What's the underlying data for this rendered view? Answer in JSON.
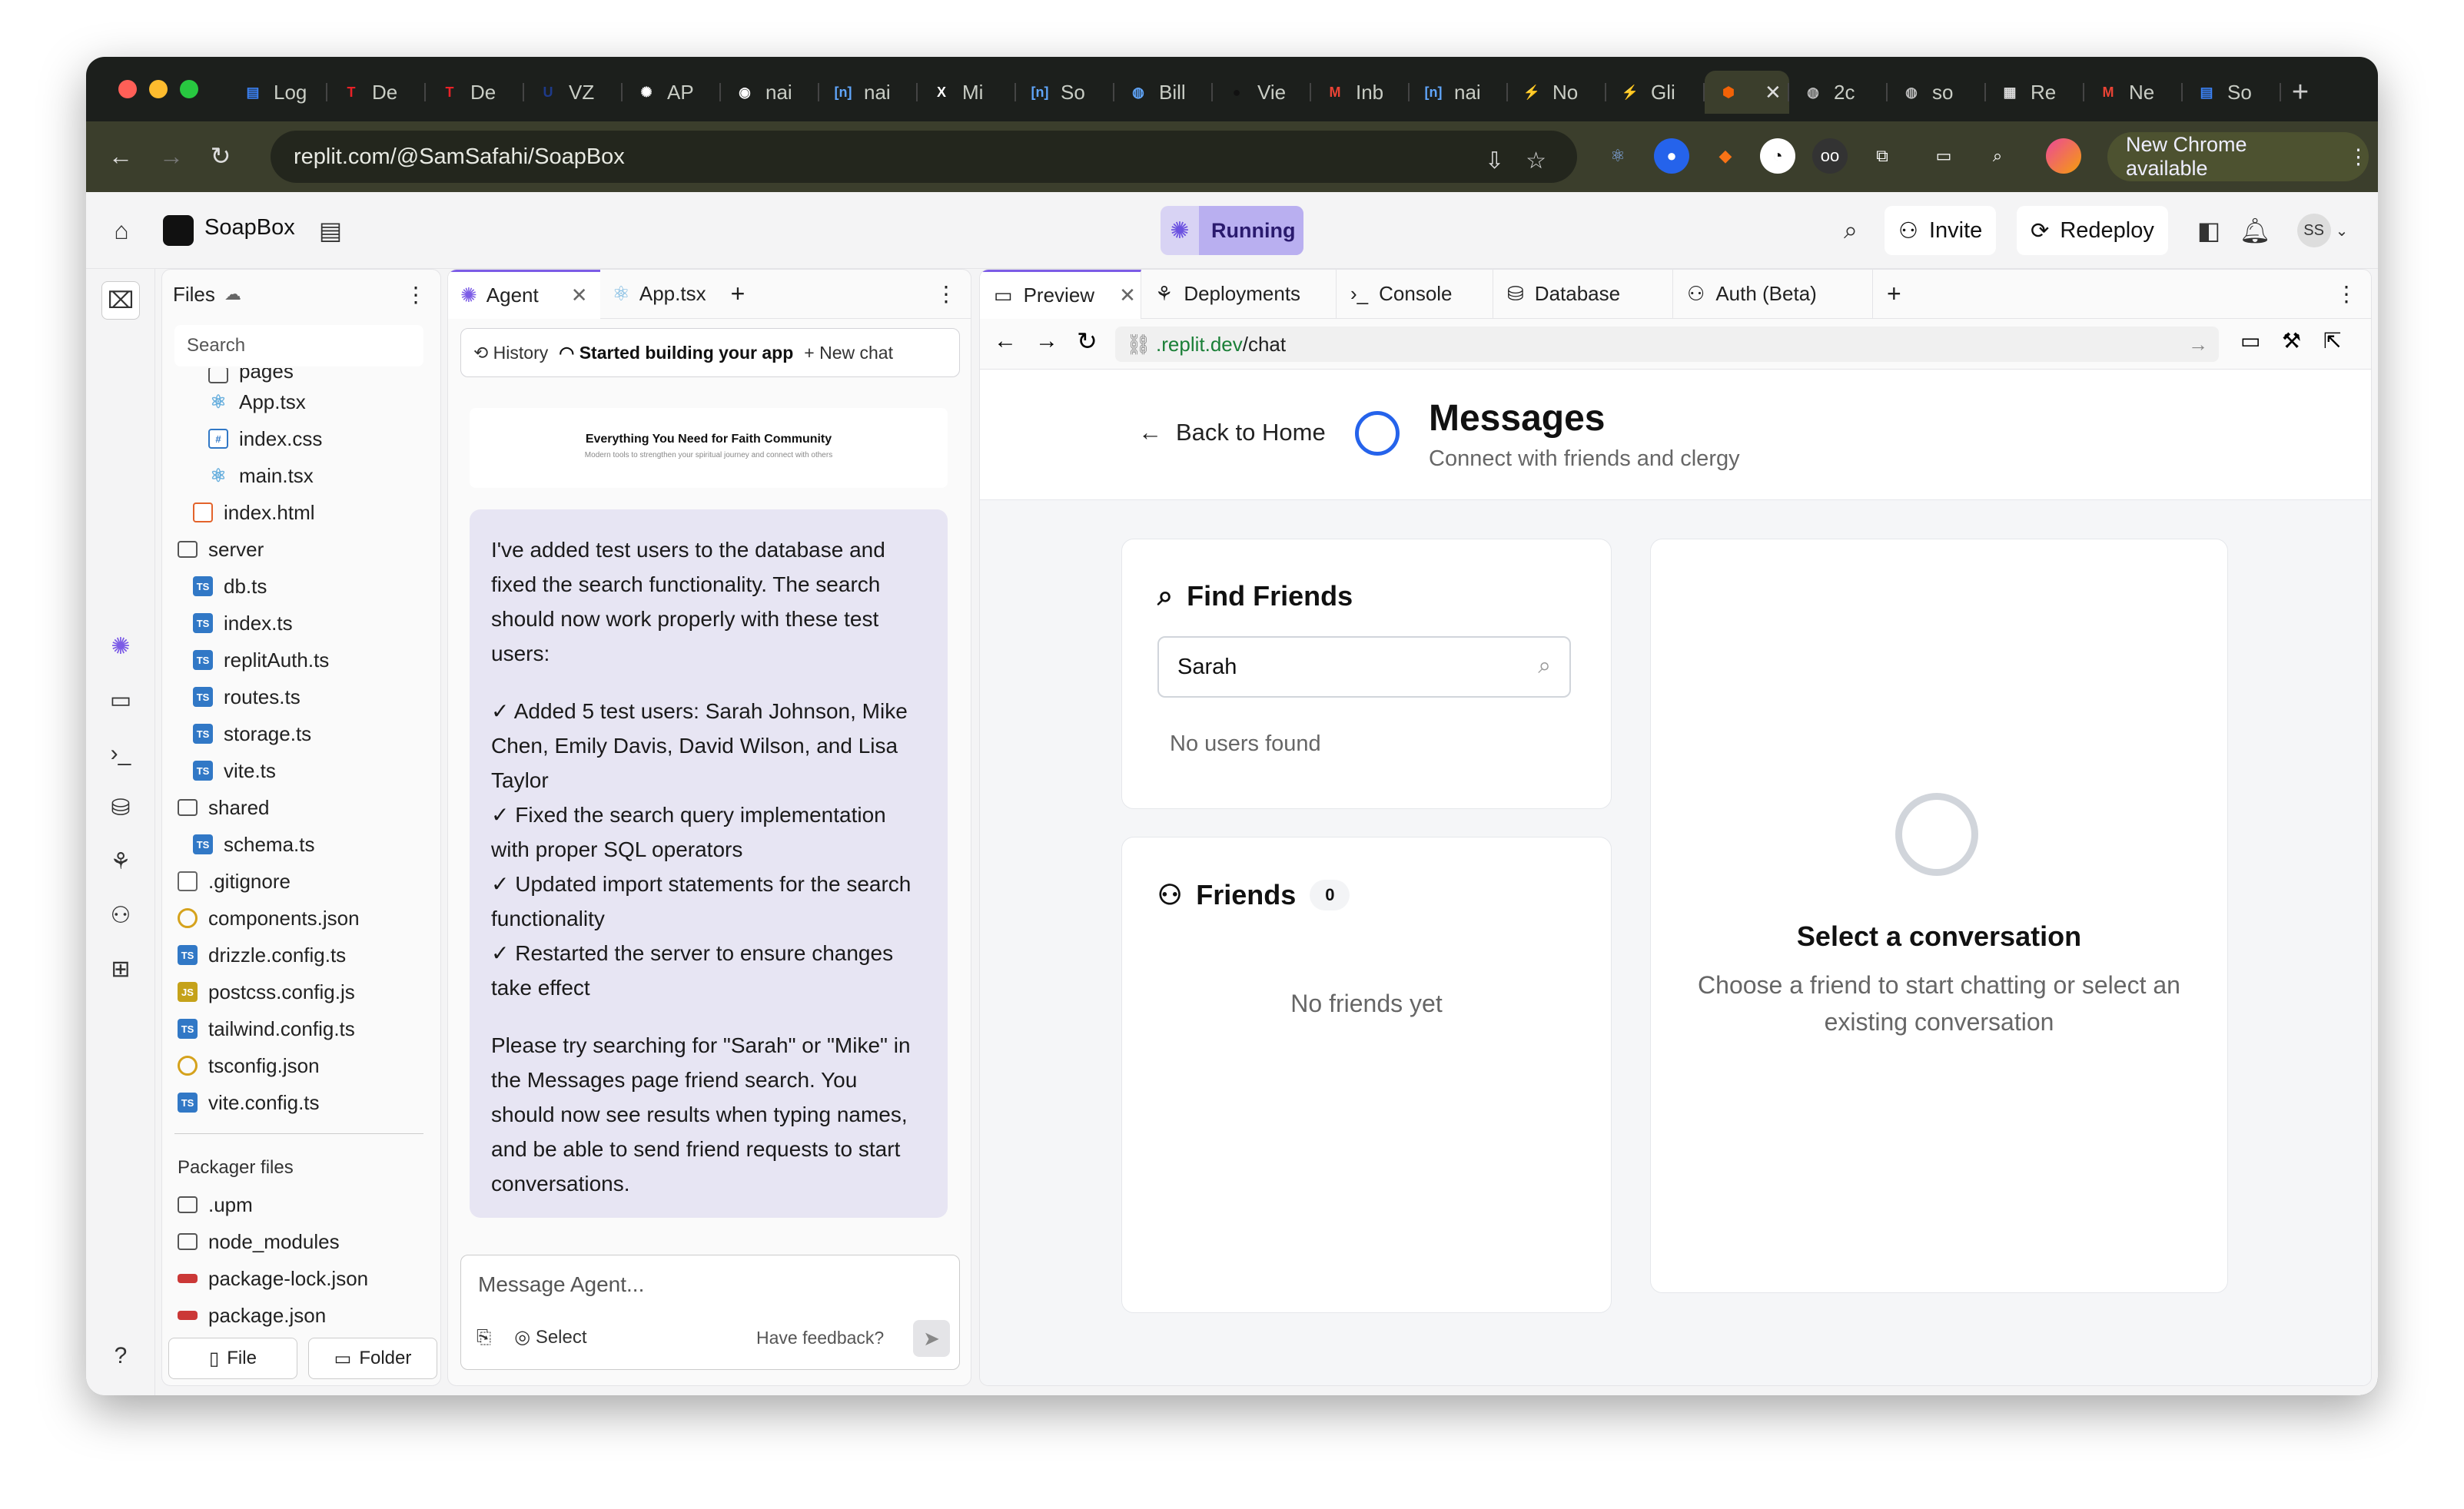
{
  "browser": {
    "tabs": [
      {
        "label": "Log",
        "fav": "doc-icon",
        "color": "#3b82f6"
      },
      {
        "label": "De",
        "fav": "tesla-icon",
        "color": "#e82127"
      },
      {
        "label": "De",
        "fav": "tesla-icon",
        "color": "#e82127"
      },
      {
        "label": "VZ",
        "fav": "ucsb-icon",
        "color": "#1e3a8a"
      },
      {
        "label": "AP",
        "fav": "openai-icon",
        "color": "#ffffff"
      },
      {
        "label": "nai",
        "fav": "github-icon",
        "color": "#ffffff"
      },
      {
        "label": "nai",
        "fav": "bracket-icon",
        "color": "#60a5fa"
      },
      {
        "label": "Mi",
        "fav": "x-icon",
        "color": "#ffffff"
      },
      {
        "label": "So",
        "fav": "bracket-icon",
        "color": "#60a5fa"
      },
      {
        "label": "Bill",
        "fav": "globe-icon",
        "color": "#60a5fa"
      },
      {
        "label": "Vie",
        "fav": "circle-icon",
        "color": "#111111"
      },
      {
        "label": "Inb",
        "fav": "gmail-icon",
        "color": "#ea4335"
      },
      {
        "label": "nai",
        "fav": "bracket-icon",
        "color": "#60a5fa"
      },
      {
        "label": "No",
        "fav": "bolt-icon",
        "color": "#ffffff"
      },
      {
        "label": "Gli",
        "fav": "bolt-icon",
        "color": "#ffffff"
      },
      {
        "label": "",
        "fav": "replit-icon",
        "color": "#f26207",
        "active": true
      },
      {
        "label": "2c",
        "fav": "globe-icon",
        "color": "#bbbbbb"
      },
      {
        "label": "so",
        "fav": "globe-icon",
        "color": "#bbbbbb"
      },
      {
        "label": "Re",
        "fav": "grid-icon",
        "color": "#dddddd"
      },
      {
        "label": "Ne",
        "fav": "gmail-icon",
        "color": "#ea4335"
      },
      {
        "label": "So",
        "fav": "doc-icon",
        "color": "#3b82f6"
      }
    ],
    "url": "replit.com/@SamSafahi/SoapBox",
    "new_chrome": "New Chrome available"
  },
  "app": {
    "project_name": "SoapBox",
    "status": "Running",
    "invite": "Invite",
    "redeploy": "Redeploy",
    "avatar": "SS"
  },
  "files": {
    "title": "Files",
    "search_placeholder": "Search",
    "items": [
      {
        "name": "pages",
        "type": "folder",
        "indent": 2
      },
      {
        "name": "App.tsx",
        "type": "react",
        "indent": 2
      },
      {
        "name": "index.css",
        "type": "css",
        "indent": 2
      },
      {
        "name": "main.tsx",
        "type": "react",
        "indent": 2
      },
      {
        "name": "index.html",
        "type": "html",
        "indent": 1
      },
      {
        "name": "server",
        "type": "folder",
        "indent": 0
      },
      {
        "name": "db.ts",
        "type": "ts",
        "indent": 1
      },
      {
        "name": "index.ts",
        "type": "ts",
        "indent": 1
      },
      {
        "name": "replitAuth.ts",
        "type": "ts",
        "indent": 1
      },
      {
        "name": "routes.ts",
        "type": "ts",
        "indent": 1
      },
      {
        "name": "storage.ts",
        "type": "ts",
        "indent": 1
      },
      {
        "name": "vite.ts",
        "type": "ts",
        "indent": 1
      },
      {
        "name": "shared",
        "type": "folder",
        "indent": 0
      },
      {
        "name": "schema.ts",
        "type": "ts",
        "indent": 1
      },
      {
        "name": ".gitignore",
        "type": "git",
        "indent": 0
      },
      {
        "name": "components.json",
        "type": "gear",
        "indent": 0
      },
      {
        "name": "drizzle.config.ts",
        "type": "ts",
        "indent": 0
      },
      {
        "name": "postcss.config.js",
        "type": "js",
        "indent": 0
      },
      {
        "name": "tailwind.config.ts",
        "type": "ts",
        "indent": 0
      },
      {
        "name": "tsconfig.json",
        "type": "gear",
        "indent": 0
      },
      {
        "name": "vite.config.ts",
        "type": "ts",
        "indent": 0
      }
    ],
    "packager_title": "Packager files",
    "packager_items": [
      {
        "name": ".upm",
        "type": "folder"
      },
      {
        "name": "node_modules",
        "type": "folder"
      },
      {
        "name": "package-lock.json",
        "type": "npm"
      },
      {
        "name": "package.json",
        "type": "npm"
      }
    ],
    "file_btn": "File",
    "folder_btn": "Folder"
  },
  "agent": {
    "tab_agent": "Agent",
    "tab_file": "App.tsx",
    "history": "History",
    "status": "Started building your app",
    "new_chat": "New chat",
    "thumb_title": "Everything You Need for Faith Community",
    "thumb_sub": "Modern tools to strengthen your spiritual journey and connect with others",
    "message": {
      "p1": "I've added test users to the database and fixed the search functionality. The search should now work properly with these test users:",
      "bullets": [
        "✓ Added 5 test users: Sarah Johnson, Mike Chen, Emily Davis, David Wilson, and Lisa Taylor",
        "✓ Fixed the search query implementation with proper SQL operators",
        "✓ Updated import statements for the search functionality",
        "✓ Restarted the server to ensure changes take effect"
      ],
      "p2": "Please try searching for \"Sarah\" or \"Mike\" in the Messages page friend search. You should now see results when typing names, and be able to send friend requests to start conversations."
    },
    "composer_placeholder": "Message Agent...",
    "select": "Select",
    "feedback": "Have feedback?"
  },
  "preview": {
    "tabs": [
      "Preview",
      "Deployments",
      "Console",
      "Database",
      "Auth (Beta)"
    ],
    "url_host": ".replit.dev",
    "url_path": "/chat",
    "back": "Back to Home",
    "title": "Messages",
    "subtitle": "Connect with friends and clergy",
    "find_friends": "Find Friends",
    "search_value": "Sarah",
    "no_users": "No users found",
    "friends": "Friends",
    "friends_count": "0",
    "no_friends": "No friends yet",
    "select_conv": "Select a conversation",
    "select_conv_sub": "Choose a friend to start chatting or select an existing conversation"
  }
}
